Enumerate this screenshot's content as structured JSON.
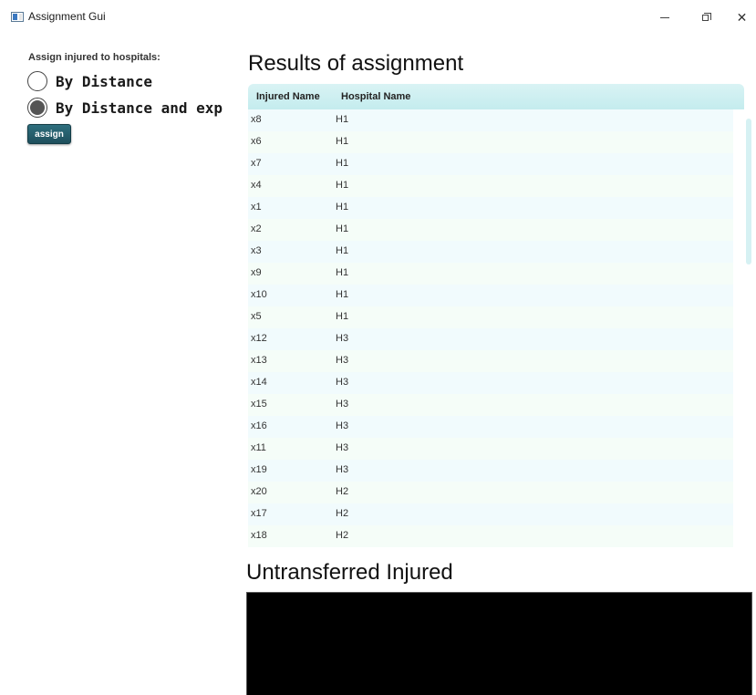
{
  "window": {
    "title": "Assignment Gui",
    "icon": "app-window-icon",
    "controls": [
      "minimize-icon",
      "restore-icon",
      "close-icon"
    ]
  },
  "sidebar": {
    "label": "Assign injured to hospitals:",
    "radios": [
      {
        "label": "By Distance",
        "selected": false
      },
      {
        "label": "By Distance and exp",
        "selected": true
      }
    ],
    "assign_button": "assign"
  },
  "results": {
    "title": "Results of assignment",
    "columns": [
      "Injured Name",
      "Hospital Name"
    ],
    "rows": [
      [
        "x8",
        "H1"
      ],
      [
        "x6",
        "H1"
      ],
      [
        "x7",
        "H1"
      ],
      [
        "x4",
        "H1"
      ],
      [
        "x1",
        "H1"
      ],
      [
        "x2",
        "H1"
      ],
      [
        "x3",
        "H1"
      ],
      [
        "x9",
        "H1"
      ],
      [
        "x10",
        "H1"
      ],
      [
        "x5",
        "H1"
      ],
      [
        "x12",
        "H3"
      ],
      [
        "x13",
        "H3"
      ],
      [
        "x14",
        "H3"
      ],
      [
        "x15",
        "H3"
      ],
      [
        "x16",
        "H3"
      ],
      [
        "x11",
        "H3"
      ],
      [
        "x19",
        "H3"
      ],
      [
        "x20",
        "H2"
      ],
      [
        "x17",
        "H2"
      ],
      [
        "x18",
        "H2"
      ]
    ]
  },
  "untransferred": {
    "title": "Untransferred Injured",
    "content": ""
  },
  "colors": {
    "header_bg": "#c4ecee",
    "row_alt_1": "#f1fbfd",
    "row_alt_2": "#f5fdf8",
    "button_bg": "#1e4f5c",
    "untransferred_bg": "#000000"
  }
}
